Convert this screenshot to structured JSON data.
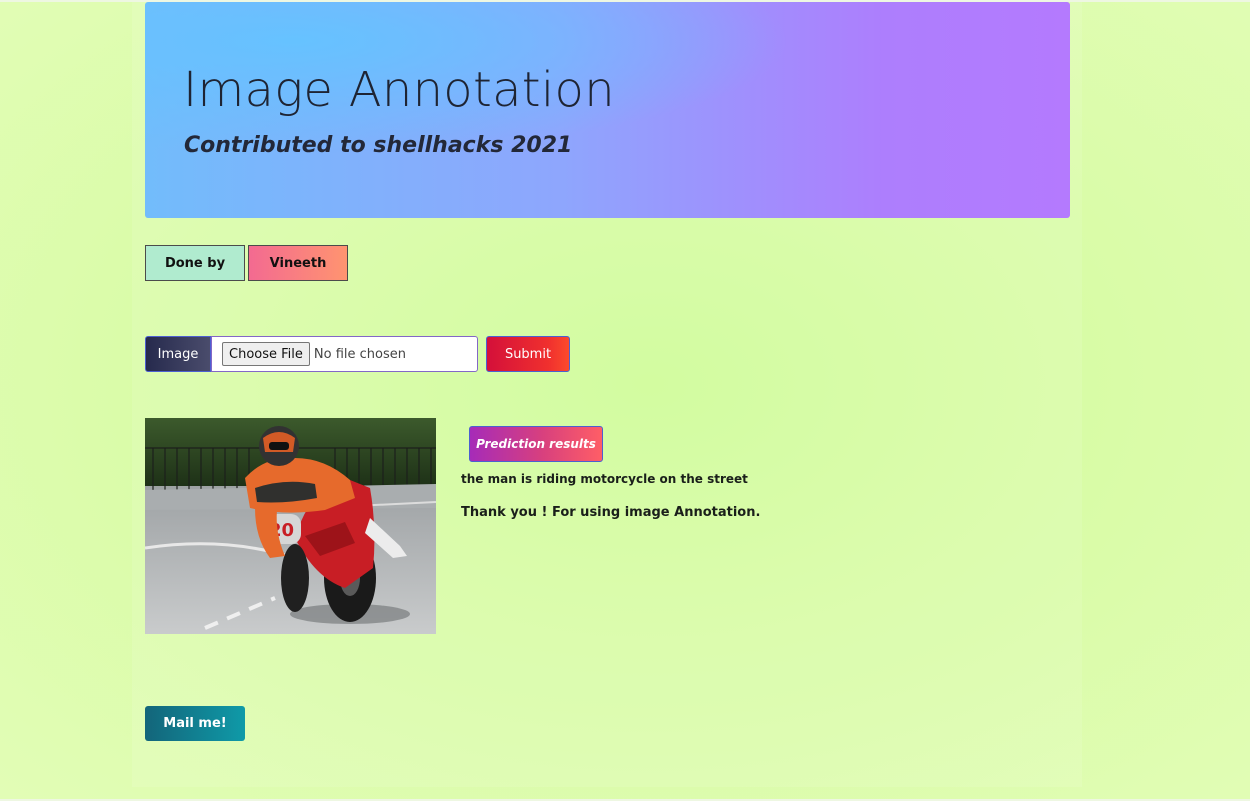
{
  "header": {
    "title": "Image Annotation",
    "subtitle_prefix": "Contributed to",
    "subtitle_event": "shellhacks 2021"
  },
  "credits": {
    "done_by_label": "Done by",
    "author": "Vineeth"
  },
  "upload_form": {
    "image_label": "Image",
    "choose_file_label": "Choose File",
    "file_status": "No file chosen",
    "submit_label": "Submit"
  },
  "prediction": {
    "button_label": "Prediction results",
    "caption": "the man is riding motorcycle on the street",
    "thank_you": "Thank you ! For using image Annotation."
  },
  "footer": {
    "mail_label": "Mail me!"
  },
  "colors": {
    "page_background": "#d6fca2",
    "header_gradient_start": "#72bcfb",
    "header_gradient_end": "#b47afe",
    "done_by_bg": "#b0ebcf",
    "author_gradient_start": "#f36a91",
    "author_gradient_end": "#ff9470",
    "submit_gradient_start": "#d4103a",
    "submit_gradient_end": "#fb4a2c",
    "prediction_gradient_start": "#a62bb8",
    "prediction_gradient_end": "#ff5e66",
    "mail_gradient_start": "#13657a",
    "mail_gradient_end": "#0f9aa8"
  }
}
